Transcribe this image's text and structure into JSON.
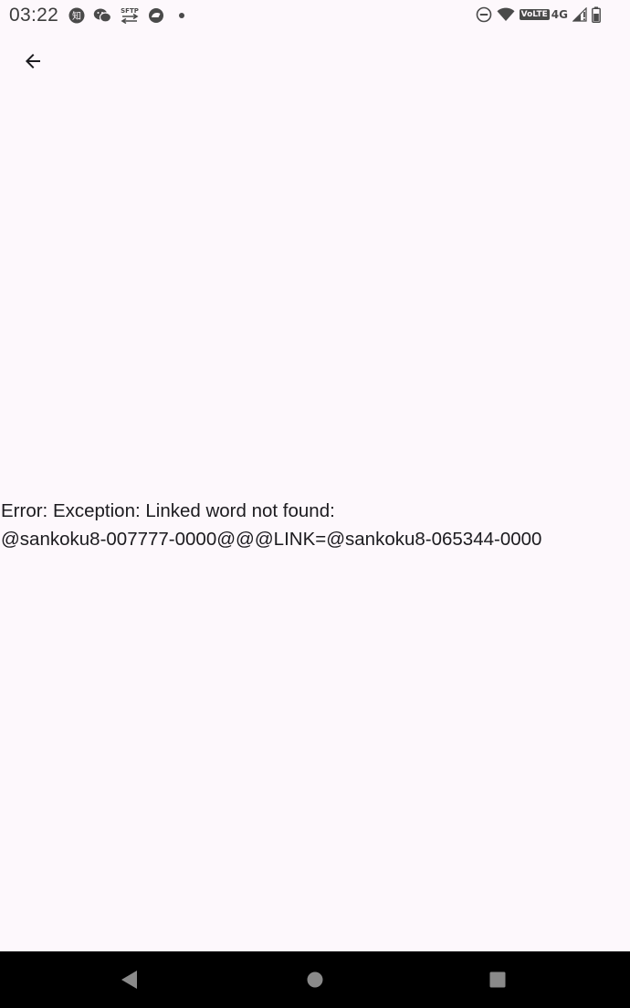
{
  "status_bar": {
    "time": "03:22",
    "notification_icons": [
      "zhihu-icon",
      "wechat-icon",
      "sftp-icon",
      "sync-icon",
      "more-dot-icon"
    ],
    "sftp_label": "SFTP",
    "zhihu_label": "知",
    "system_icons": [
      "dnd-icon",
      "wifi-icon",
      "volte-icon",
      "signal-icon",
      "battery-icon"
    ],
    "volte_label": "VoLTE",
    "network_type": "4G"
  },
  "app_bar": {
    "back_icon": "arrow-back-icon"
  },
  "content": {
    "error_text": "Error: Exception: Linked word not found:\n@sankoku8-007777-0000@@@LINK=@sankoku8-065344-0000"
  },
  "nav_bar": {
    "buttons": [
      "nav-back",
      "nav-home",
      "nav-recents"
    ],
    "background": "#000000",
    "icon_color": "#8a8a8a"
  },
  "colors": {
    "page_background": "#fdf8fc",
    "text": "#1c1b1f",
    "status_icons": "#4a4a4a"
  }
}
